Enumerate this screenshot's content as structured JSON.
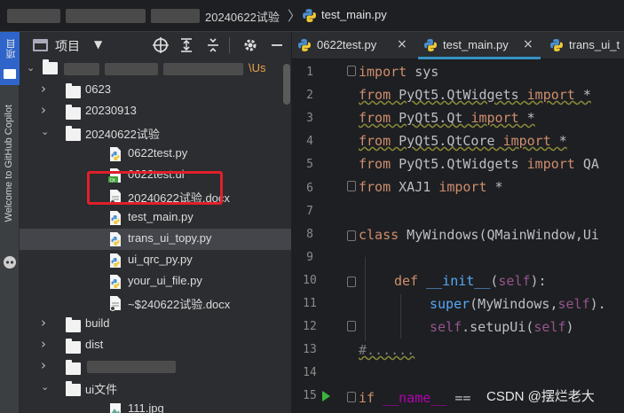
{
  "breadcrumb": {
    "folder": "20240622试验",
    "separator": "〉",
    "file": "test_main.py"
  },
  "left_strip": {
    "project_label": "项目",
    "copilot_label": "Welcome to GitHub Copilot"
  },
  "project_panel": {
    "title": "项目",
    "dropdown_icon": "▼",
    "header_icons": [
      "crosshair-icon",
      "expand-all-icon",
      "collapse-all-icon",
      "gear-icon",
      "minimize-icon"
    ],
    "root_suffix": "\\Us",
    "items": [
      {
        "label": "0623",
        "type": "folder",
        "expanded": false
      },
      {
        "label": "20230913",
        "type": "folder",
        "expanded": false
      },
      {
        "label": "20240622试验",
        "type": "folder",
        "expanded": true
      },
      {
        "label": "0622test.py",
        "type": "py"
      },
      {
        "label": "0622test.ui",
        "type": "ui"
      },
      {
        "label": "20240622试验.docx",
        "type": "docx"
      },
      {
        "label": "test_main.py",
        "type": "py"
      },
      {
        "label": "trans_ui_topy.py",
        "type": "py",
        "selected": true
      },
      {
        "label": "ui_qrc_py.py",
        "type": "py"
      },
      {
        "label": "your_ui_file.py",
        "type": "py"
      },
      {
        "label": "~$240622试验.docx",
        "type": "docx"
      },
      {
        "label": "build",
        "type": "folder",
        "expanded": false
      },
      {
        "label": "dist",
        "type": "folder",
        "expanded": false
      },
      {
        "label": "",
        "type": "folder",
        "expanded": false
      },
      {
        "label": "ui文件",
        "type": "folder",
        "expanded": true
      },
      {
        "label": "111.jpg",
        "type": "jpg"
      }
    ]
  },
  "editor": {
    "tabs": [
      {
        "label": "0622test.py",
        "close": "×",
        "active": false
      },
      {
        "label": "test_main.py",
        "close": "×",
        "active": true
      },
      {
        "label": "trans_ui_t",
        "close": "",
        "active": false
      }
    ],
    "line_numbers": [
      "1",
      "2",
      "3",
      "4",
      "5",
      "6",
      "7",
      "8",
      "9",
      "10",
      "11",
      "12",
      "13",
      "14",
      "15"
    ],
    "code": {
      "l1_kw": "import",
      "l1_rest": " sys",
      "l2_kw": "from",
      "l2_mod": " PyQt5.QtWidgets ",
      "l2_kw2": "import",
      "l2_rest": " *",
      "l3_kw": "from",
      "l3_mod": " PyQt5.Qt ",
      "l3_kw2": "import",
      "l3_rest": " *",
      "l4_kw": "from",
      "l4_mod": " PyQt5.QtCore ",
      "l4_kw2": "import",
      "l4_rest": " *",
      "l5_kw": "from",
      "l5_mod": " PyQt5.QtWidgets ",
      "l5_kw2": "import",
      "l5_rest": " QA",
      "l6_kw": "from",
      "l6_mod": " XAJ1 ",
      "l6_kw2": "import",
      "l6_rest": " *",
      "l8_kw": "class",
      "l8_rest": " MyWindows(QMainWindow,Ui",
      "l10_kw": "def",
      "l10_fn": "__init__",
      "l10_p1": "(",
      "l10_self": "self",
      "l10_p2": "):",
      "l11_fn": "super",
      "l11_p1": "(MyWindows,",
      "l11_self": "self",
      "l11_p2": ").",
      "l12_self": "self",
      "l12_rest": ".setupUi(",
      "l12_self2": "self",
      "l12_p2": ")",
      "l13": "#......",
      "l15_kw": "if",
      "l15_magic": " __name__",
      "l15_rest": " == "
    }
  },
  "watermark": "CSDN @摆烂老大"
}
